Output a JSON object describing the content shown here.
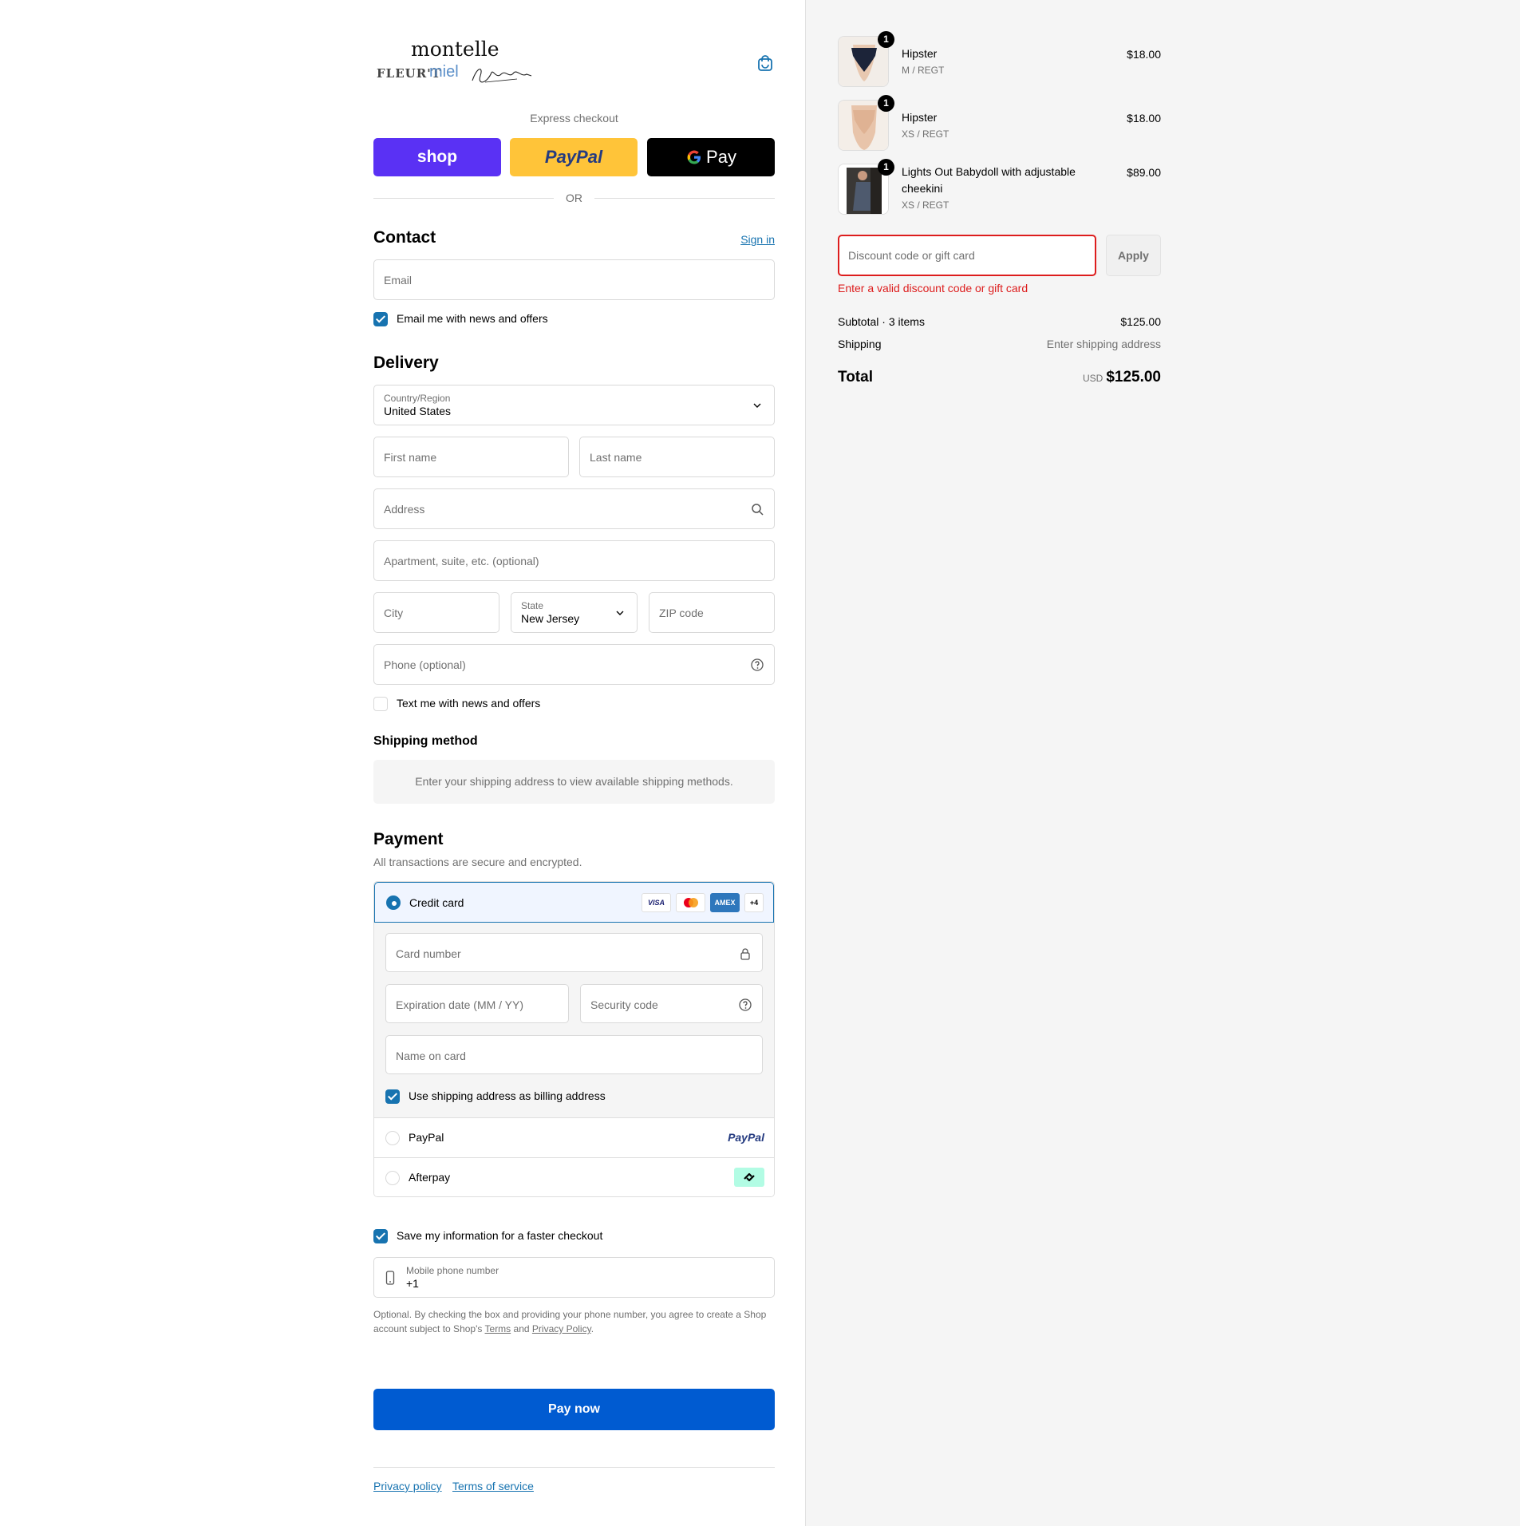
{
  "brand": {
    "logo_primary": "montelle",
    "logo_secondary": "FLEUR'T",
    "logo_tertiary": "miel",
    "logo_script": "Signature Collection"
  },
  "express": {
    "label": "Express checkout",
    "shop_label": "shop",
    "paypal_label": "PayPal",
    "gpay_label": "Pay",
    "divider": "OR"
  },
  "contact": {
    "heading": "Contact",
    "sign_in": "Sign in",
    "email_placeholder": "Email",
    "email_news_label": "Email me with news and offers",
    "email_news_checked": true
  },
  "delivery": {
    "heading": "Delivery",
    "country_label": "Country/Region",
    "country_value": "United States",
    "first_name_placeholder": "First name",
    "last_name_placeholder": "Last name",
    "address_placeholder": "Address",
    "apartment_placeholder": "Apartment, suite, etc. (optional)",
    "city_placeholder": "City",
    "state_label": "State",
    "state_value": "New Jersey",
    "zip_placeholder": "ZIP code",
    "phone_placeholder": "Phone (optional)",
    "text_news_label": "Text me with news and offers",
    "text_news_checked": false
  },
  "shipping_method": {
    "heading": "Shipping method",
    "message": "Enter your shipping address to view available shipping methods."
  },
  "payment": {
    "heading": "Payment",
    "subtitle": "All transactions are secure and encrypted.",
    "credit_card_label": "Credit card",
    "card_brands": [
      "VISA",
      "MC",
      "AMEX",
      "+4"
    ],
    "card_number_placeholder": "Card number",
    "expiration_placeholder": "Expiration date (MM / YY)",
    "security_placeholder": "Security code",
    "name_placeholder": "Name on card",
    "billing_same_label": "Use shipping address as billing address",
    "paypal_label": "PayPal",
    "paypal_logo": "PayPal",
    "afterpay_label": "Afterpay"
  },
  "save_info": {
    "label": "Save my information for a faster checkout",
    "mobile_label": "Mobile phone number",
    "mobile_value": "+1",
    "fineprint_1": "Optional. By checking the box and providing your phone number, you agree to create a Shop account subject to Shop's",
    "terms": "Terms",
    "and": "and",
    "privacy": "Privacy Policy",
    "period": "."
  },
  "pay_now": "Pay now",
  "footer": {
    "privacy": "Privacy policy",
    "terms": "Terms of service"
  },
  "cart": {
    "items": [
      {
        "name": "Hipster",
        "variant": "M / REGT",
        "price": "$18.00",
        "qty": "1"
      },
      {
        "name": "Hipster",
        "variant": "XS / REGT",
        "price": "$18.00",
        "qty": "1"
      },
      {
        "name": "Lights Out Babydoll with adjustable cheekini",
        "variant": "XS / REGT",
        "price": "$89.00",
        "qty": "1"
      }
    ],
    "discount_placeholder": "Discount code or gift card",
    "apply": "Apply",
    "discount_error": "Enter a valid discount code or gift card",
    "subtotal_label": "Subtotal · 3 items",
    "subtotal_value": "$125.00",
    "shipping_label": "Shipping",
    "shipping_value": "Enter shipping address",
    "total_label": "Total",
    "currency": "USD",
    "total_value": "$125.00"
  },
  "colors": {
    "accent": "#1773b0",
    "pay_button": "#005bd1",
    "shop": "#5a31f4",
    "paypal": "#ffc439",
    "error": "#dd1d1d"
  }
}
